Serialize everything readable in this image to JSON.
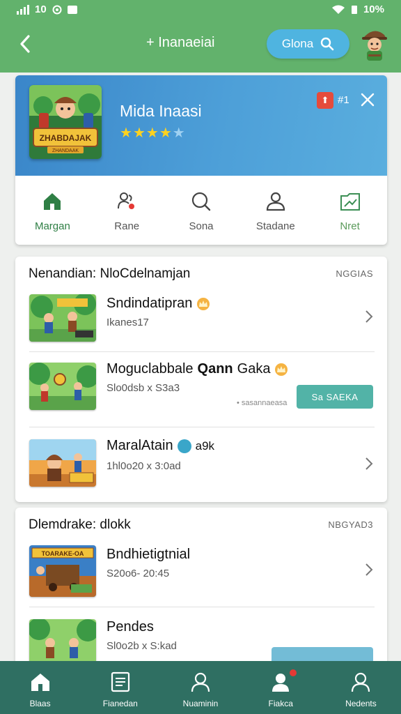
{
  "status": {
    "signal": "10",
    "battery": "10%"
  },
  "appbar": {
    "title": "+ Inanaeiai",
    "pill_label": "Glona",
    "back_icon": "back-arrow-icon",
    "search_icon": "search-icon"
  },
  "hero": {
    "art_title": "ZHABDAJAK",
    "art_subtitle": "ZHANDAAK",
    "name": "Mida Inaasi",
    "rating": 4,
    "rating_max": 5,
    "badge_glyph": "⬆",
    "badge_num": "#1",
    "tabs": [
      {
        "label": "Margan",
        "icon": "home-icon"
      },
      {
        "label": "Rane",
        "icon": "people-alert-icon"
      },
      {
        "label": "Sona",
        "icon": "search-icon"
      },
      {
        "label": "Stadane",
        "icon": "profile-icon"
      },
      {
        "label": "Nret",
        "icon": "folder-chart-icon"
      }
    ]
  },
  "section1": {
    "heading": "Nenandian: NloCdelnamjan",
    "tag": "NGGIAS",
    "items": [
      {
        "name": "Sndindatipran",
        "sub": "Ikanes17",
        "badge": "crown"
      },
      {
        "name": "Moguclabbale ",
        "name_bold": "Qann",
        "name_tail": " Gaka",
        "sub": "Slo0dsb x S3a3",
        "button": "Sa SAEKA",
        "note": "• sasannaeasa"
      },
      {
        "name": "MaralAtain",
        "sub": "1hl0o20 x 3:0ad",
        "badge_text": "a9k"
      }
    ]
  },
  "section2": {
    "heading": "Dlemdrake: dlokk",
    "tag": "NBGYAD3",
    "items": [
      {
        "name": "Bndhietigtnial",
        "sub": "S20o6- 20:45",
        "art_text": "TOARAKE-OA"
      },
      {
        "name": "Pendes",
        "sub": "Sl0o2b x S:kad"
      }
    ]
  },
  "bottom_nav": [
    {
      "label": "Blaas",
      "icon": "home-icon"
    },
    {
      "label": "Fianedan",
      "icon": "document-list-icon"
    },
    {
      "label": "Nuaminin",
      "icon": "person-icon"
    },
    {
      "label": "Fiakca",
      "icon": "profile-notification-icon"
    },
    {
      "label": "Nedents",
      "icon": "user-icon"
    }
  ],
  "colors": {
    "appbar": "#62b26c",
    "accent": "#4fb4e0",
    "nav": "#2f6f62",
    "button": "#52b3a7"
  }
}
